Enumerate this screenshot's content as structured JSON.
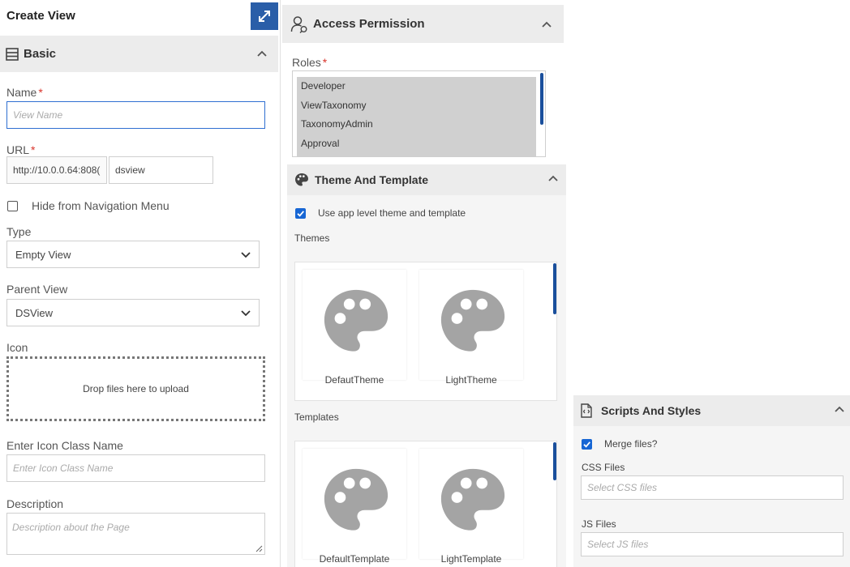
{
  "left": {
    "title": "Create View",
    "basic_section": {
      "title": "Basic"
    },
    "name": {
      "label": "Name",
      "required_mark": "*",
      "placeholder": "View Name"
    },
    "url": {
      "label": "URL",
      "required_mark": "*",
      "prefix_value": "http://10.0.0.64:808(",
      "suffix_value": "dsview"
    },
    "hide_nav": {
      "label": "Hide from Navigation Menu",
      "checked": false
    },
    "type": {
      "label": "Type",
      "selected": "Empty View"
    },
    "parent_view": {
      "label": "Parent View",
      "selected": "DSView"
    },
    "icon": {
      "label": "Icon",
      "dropzone_text": "Drop files here to upload"
    },
    "icon_class": {
      "label": "Enter Icon Class Name",
      "placeholder": "Enter Icon Class Name"
    },
    "description": {
      "label": "Description",
      "placeholder": "Description about the Page"
    }
  },
  "access": {
    "title": "Access Permission",
    "roles_label": "Roles",
    "required_mark": "*",
    "roles": [
      "Developer",
      "ViewTaxonomy",
      "TaxonomyAdmin",
      "Approval"
    ]
  },
  "theme": {
    "title": "Theme And Template",
    "use_app_level_label": "Use app level theme and template",
    "use_app_level_checked": true,
    "themes_label": "Themes",
    "themes": [
      "DefautTheme",
      "LightTheme"
    ],
    "templates_label": "Templates",
    "templates": [
      "DefaultTemplate",
      "LightTemplate"
    ]
  },
  "scripts": {
    "title": "Scripts And Styles",
    "merge_label": "Merge files?",
    "merge_checked": true,
    "css_label": "CSS Files",
    "css_placeholder": "Select CSS files",
    "js_label": "JS Files",
    "js_placeholder": "Select JS files"
  },
  "colors": {
    "accent": "#1766d4",
    "header_bg": "#ececec",
    "expand_button": "#2a5ea8",
    "scrollbar": "#1a4f9c"
  }
}
